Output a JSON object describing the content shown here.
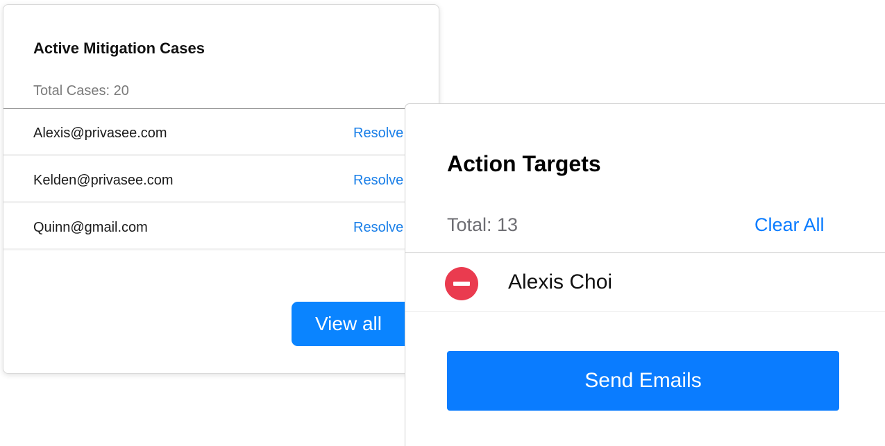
{
  "cases_card": {
    "title": "Active Mitigation Cases",
    "total": "Total Cases:  20",
    "rows": [
      {
        "email": "Alexis@privasee.com",
        "action": "Resolve"
      },
      {
        "email": "Kelden@privasee.com",
        "action": "Resolve"
      },
      {
        "email": "Quinn@gmail.com",
        "action": "Resolve"
      }
    ],
    "view_all_label": "View all"
  },
  "action_targets": {
    "title": "Action Targets",
    "total": "Total: 13",
    "clear_all_label": "Clear All",
    "items": [
      {
        "name": "Alexis Choi",
        "icon": "remove-circle-icon"
      }
    ],
    "send_label": "Send Emails"
  },
  "colors": {
    "accent": "#0a7cff",
    "remove": "#ea3b4f"
  }
}
